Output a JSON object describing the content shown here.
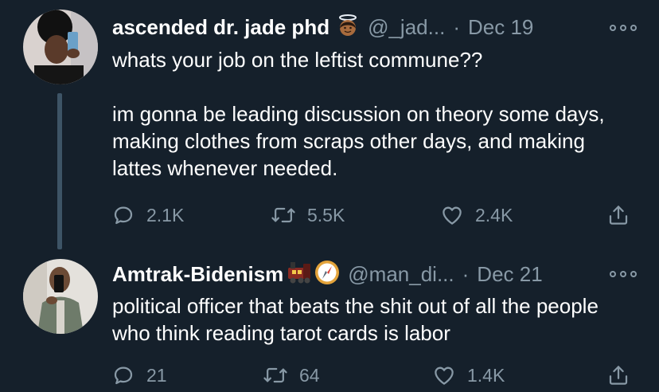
{
  "tweets": [
    {
      "display_name": "ascended dr. jade phd",
      "name_emoji": [
        "angel-face-emoji"
      ],
      "handle": "@_jad...",
      "date": "Dec 19",
      "text_paragraphs": [
        "whats your job on the leftist commune??",
        "im gonna be leading discussion on theory some days, making clothes from scraps other days, and making lattes whenever needed."
      ],
      "reply_count": "2.1K",
      "retweet_count": "5.5K",
      "like_count": "2.4K"
    },
    {
      "display_name": "Amtrak-Bidenism",
      "name_emoji": [
        "train-emoji",
        "compass-emoji"
      ],
      "handle": "@man_di...",
      "date": "Dec 21",
      "text_paragraphs": [
        "political officer that beats the shit out of all the people who think reading tarot cards is labor"
      ],
      "reply_count": "21",
      "retweet_count": "64",
      "like_count": "1.4K"
    }
  ],
  "colors": {
    "background": "#15202b",
    "text_primary": "#ffffff",
    "text_secondary": "#8899a6",
    "thread_line": "#3d5466"
  }
}
